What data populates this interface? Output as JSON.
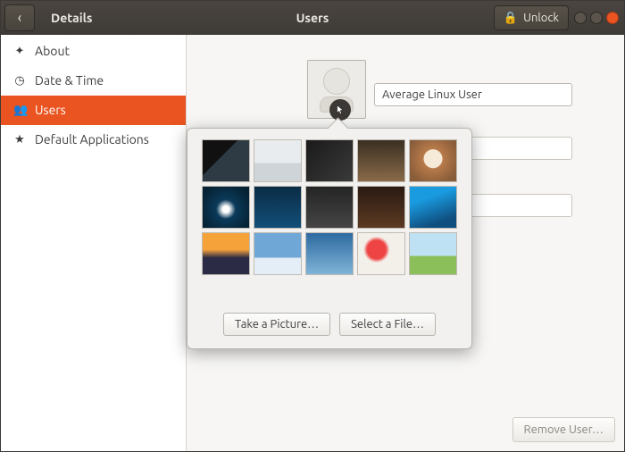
{
  "titlebar": {
    "panel_label": "Details",
    "page_label": "Users",
    "unlock_label": "Unlock"
  },
  "sidebar": {
    "items": [
      {
        "label": "About",
        "icon": "✦"
      },
      {
        "label": "Date & Time",
        "icon": "◷"
      },
      {
        "label": "Users",
        "icon": "👥"
      },
      {
        "label": "Default Applications",
        "icon": "★"
      }
    ],
    "active_index": 2
  },
  "user": {
    "full_name": "Average Linux User"
  },
  "avatar_popover": {
    "stock_images": [
      "bicycle-night",
      "open-book",
      "calculator-clips",
      "cat",
      "latte-art",
      "white-lily-blue",
      "wave-dark",
      "guitar-dark",
      "headphones-dark",
      "hummingbird",
      "sunset-mountain",
      "airplane-wing",
      "surfer-wave",
      "tomatoes",
      "lone-tree-field"
    ],
    "take_picture_label": "Take a Picture…",
    "select_file_label": "Select a File…"
  },
  "actions": {
    "remove_user_label": "Remove User…"
  },
  "icons": {
    "back": "‹",
    "lock": "🔒"
  }
}
